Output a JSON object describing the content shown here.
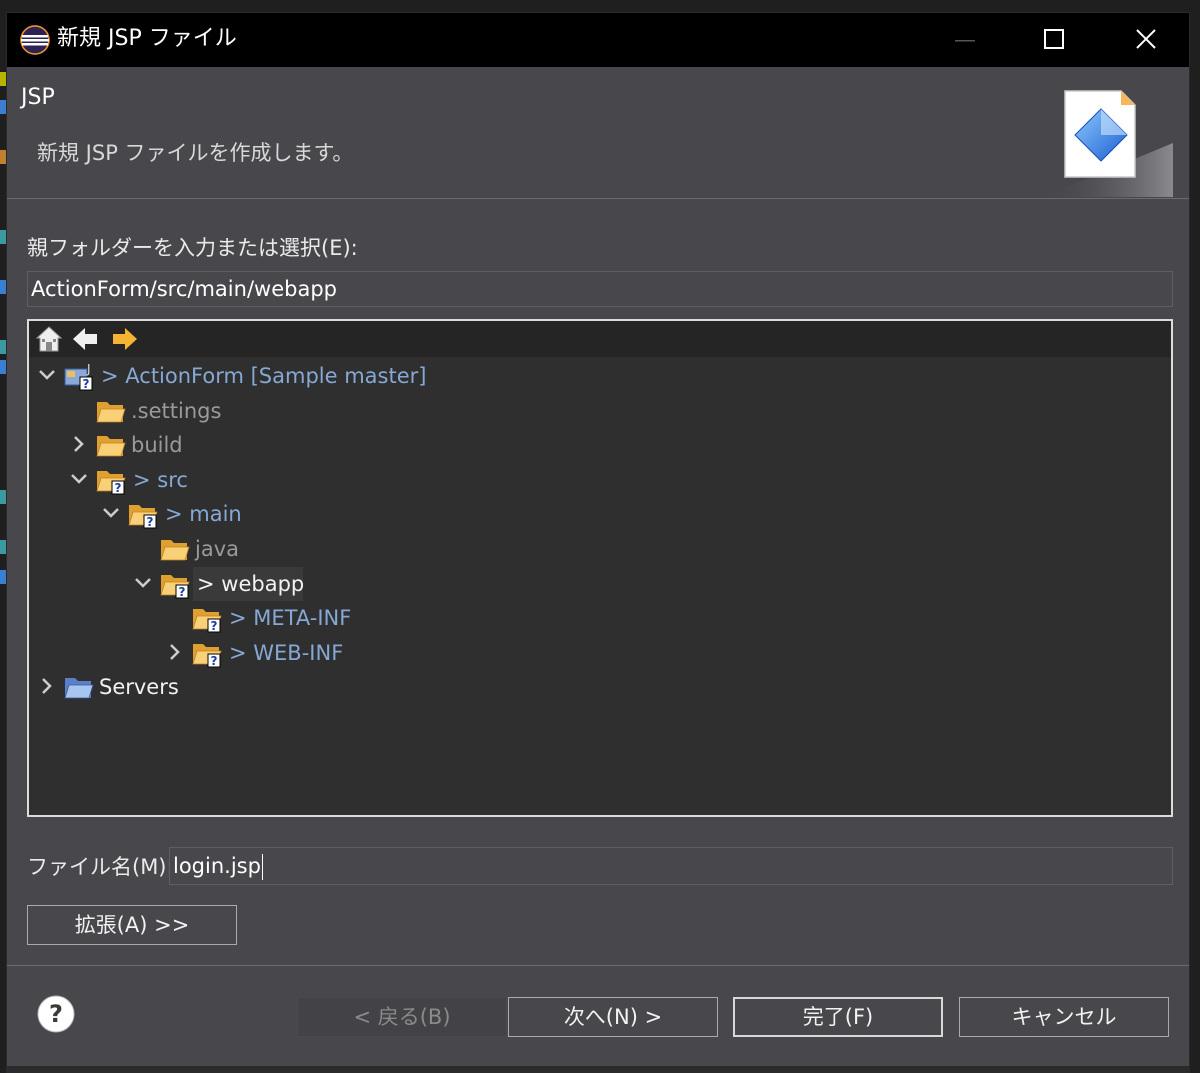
{
  "window": {
    "title": "新規 JSP ファイル"
  },
  "header": {
    "title": "JSP",
    "description": "新規 JSP ファイルを作成します。"
  },
  "parent_folder": {
    "label": "親フォルダーを入力または選択(E):",
    "value": "ActionForm/src/main/webapp"
  },
  "tree": {
    "items": [
      {
        "label": "> ActionForm [Sample master]"
      },
      {
        "label": ".settings"
      },
      {
        "label": "build"
      },
      {
        "label": "> src"
      },
      {
        "label": "> main"
      },
      {
        "label": "java"
      },
      {
        "label": "> webapp"
      },
      {
        "label": "> META-INF"
      },
      {
        "label": "> WEB-INF"
      },
      {
        "label": "Servers"
      }
    ]
  },
  "file_name": {
    "label": "ファイル名(M):",
    "value": "login.jsp"
  },
  "advanced_button": "拡張(A) >>",
  "buttons": {
    "back": "< 戻る(B)",
    "next": "次へ(N) >",
    "finish": "完了(F)",
    "cancel": "キャンセル"
  },
  "colors": {
    "dialog_bg": "#48484c",
    "tree_bg": "#2f2f2f",
    "titlebar": "#000000",
    "git_label": "#86a8d4"
  }
}
